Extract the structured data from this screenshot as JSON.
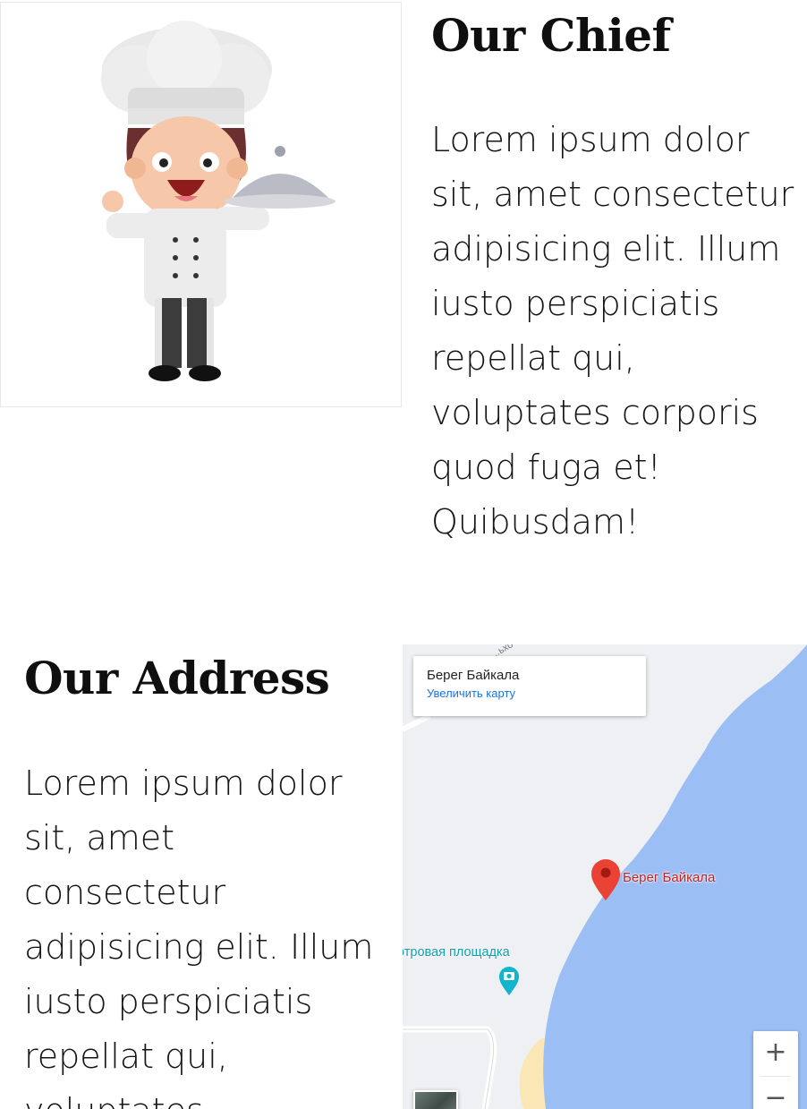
{
  "chief": {
    "title": "Our Chief",
    "text": "Lorem ipsum dolor sit, amet consectetur adipisicing elit. Illum iusto perspiciatis repellat qui, voluptates corporis quod fuga et! Quibusdam!"
  },
  "address": {
    "title": "Our Address",
    "text": "Lorem ipsum dolor sit, amet consectetur adipisicing elit. Illum iusto perspiciatis repellat qui, voluptates"
  },
  "map": {
    "card_title": "Берег Байкала",
    "card_link": "Увеличить карту",
    "pin_label": "Берег Байкала",
    "poi_label": "отровая площадка",
    "road_label": "...ьхо",
    "zoom_in": "+",
    "zoom_out": "−",
    "colors": {
      "water": "#9bbff5",
      "land": "#eef0f3",
      "pin": "#ea4335",
      "poi": "#12b5cb",
      "link": "#1a73e8",
      "sand": "#fbe7b5"
    }
  }
}
